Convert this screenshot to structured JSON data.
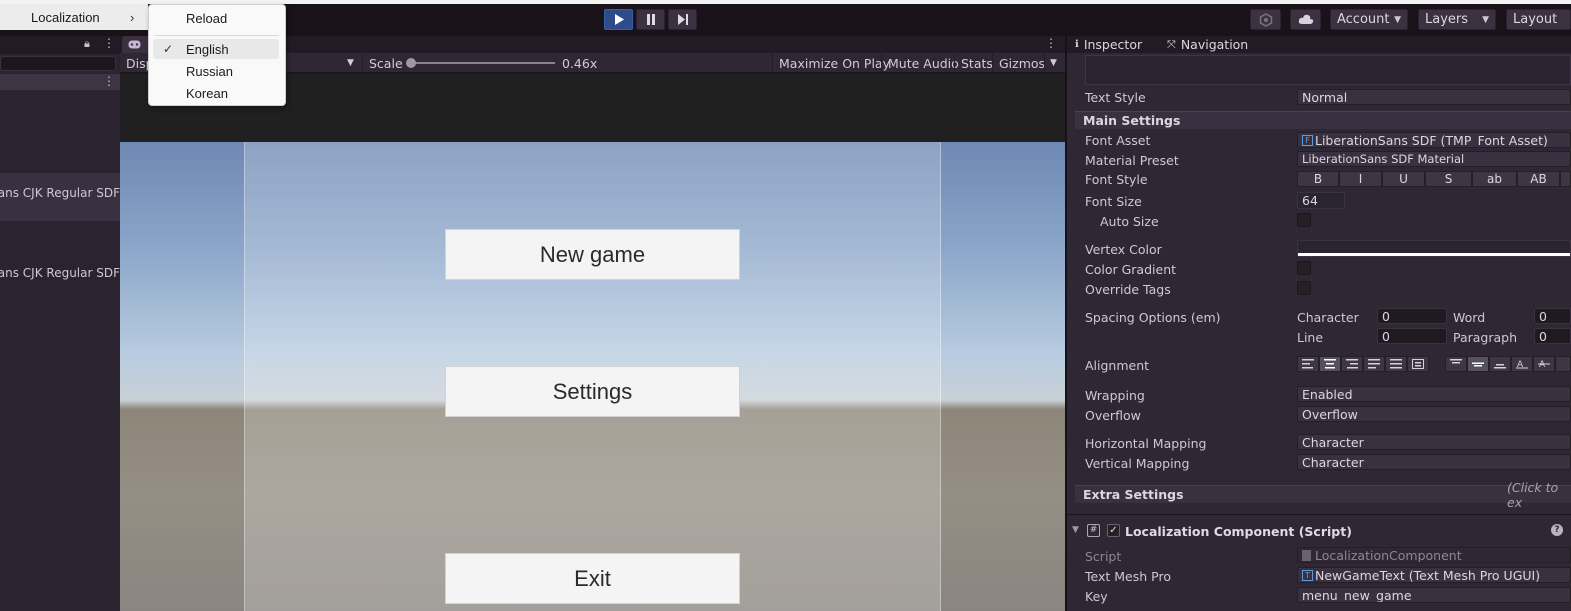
{
  "menu": {
    "localization_label": "Localization",
    "submenu": {
      "reload": "Reload",
      "languages": [
        "English",
        "Russian",
        "Korean"
      ],
      "selected": "English"
    }
  },
  "toolbar": {
    "account": "Account",
    "layers": "Layers",
    "layout": "Layout",
    "play_state": "playing"
  },
  "hierarchy": {
    "items": [
      "Noto Sans CJK Regular SDF",
      "Noto Sans CJK Regular SDF"
    ]
  },
  "game_view": {
    "display_label": "Disp",
    "scale_label": "Scale",
    "scale_value": "0.46x",
    "scale_fraction": 0.0,
    "maximize_on_play": "Maximize On Play",
    "mute_audio": "Mute Audio",
    "stats": "Stats",
    "gizmos": "Gizmos",
    "buttons": [
      "New game",
      "Settings",
      "Exit"
    ]
  },
  "inspector": {
    "tabs": [
      "Inspector",
      "Navigation"
    ],
    "text_style_label": "Text Style",
    "text_style_value": "Normal",
    "main_settings": "Main Settings",
    "font_asset_label": "Font Asset",
    "font_asset_value": "LiberationSans SDF (TMP_Font Asset)",
    "material_preset_label": "Material Preset",
    "material_preset_value": "LiberationSans SDF Material",
    "font_style_label": "Font Style",
    "font_style_buttons": [
      "B",
      "I",
      "U",
      "S",
      "ab",
      "AB"
    ],
    "font_size_label": "Font Size",
    "font_size_value": "64",
    "auto_size_label": "Auto Size",
    "vertex_color_label": "Vertex Color",
    "color_gradient_label": "Color Gradient",
    "override_tags_label": "Override Tags",
    "spacing_label": "Spacing Options (em)",
    "spacing": {
      "character_label": "Character",
      "character_value": "0",
      "word_label": "Word",
      "word_value": "0",
      "line_label": "Line",
      "line_value": "0",
      "paragraph_label": "Paragraph",
      "paragraph_value": "0"
    },
    "alignment_label": "Alignment",
    "wrapping_label": "Wrapping",
    "wrapping_value": "Enabled",
    "overflow_label": "Overflow",
    "overflow_value": "Overflow",
    "horizontal_mapping_label": "Horizontal Mapping",
    "horizontal_mapping_value": "Character",
    "vertical_mapping_label": "Vertical Mapping",
    "vertical_mapping_value": "Character",
    "extra_settings": "Extra Settings",
    "extra_settings_hint": "(Click to ex",
    "component_title": "Localization Component (Script)",
    "script_label": "Script",
    "script_value": "LocalizationComponent",
    "text_mesh_pro_label": "Text Mesh Pro",
    "text_mesh_pro_value": "NewGameText (Text Mesh Pro UGUI)",
    "key_label": "Key",
    "key_value": "menu_new_game"
  },
  "colors": {
    "accent_play": "#2e4c8a",
    "panel_bg": "#2f2734",
    "header_bg": "#221b26"
  }
}
